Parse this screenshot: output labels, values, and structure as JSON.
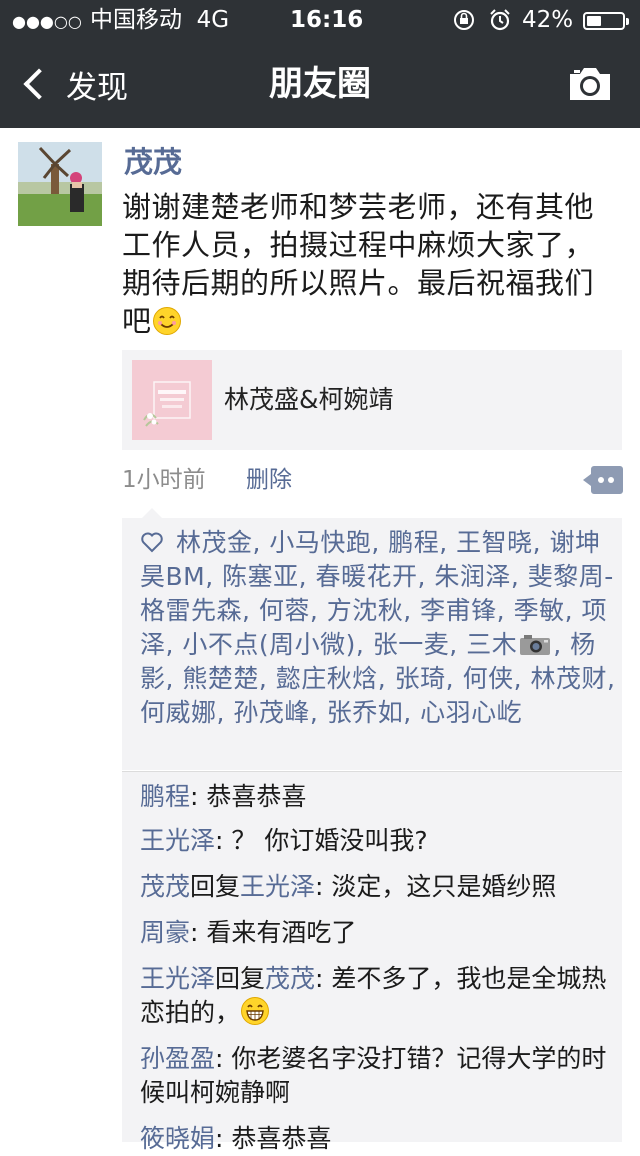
{
  "status_bar": {
    "signal": "●●●○○",
    "carrier": "中国移动",
    "network": "4G",
    "time": "16:16",
    "battery_percent": "42%",
    "battery_level": 0.42
  },
  "nav": {
    "back_label": "发现",
    "title": "朋友圈",
    "right_icon": "camera-icon"
  },
  "post": {
    "author": "茂茂",
    "text": "谢谢建楚老师和梦芸老师，还有其他工作人员，拍摄过程中麻烦大家了，期待后期的所以照片。最后祝福我们吧",
    "link_title": "林茂盛&柯婉靖",
    "time_ago": "1小时前",
    "delete_label": "删除"
  },
  "likes": {
    "part1": "林茂金, 小马快跑, 鹏程, 王智晓, 谢坤昊BM, 陈塞亚, 春暖花开, 朱润泽, 斐黎周-格雷先森, 何蓉, 方沈秋, 李甫锋, 季敏, 项泽, 小不点(周小微), 张一麦, 三木",
    "part2": ", 杨 影, 熊楚楚, 懿庄秋焓, 张琦, 何侠, 林茂财, 何威娜, 孙茂峰, 张乔如, 心羽心屹"
  },
  "comments": [
    {
      "name": "鹏程",
      "text": ": 恭喜恭喜"
    },
    {
      "name": "王光泽",
      "text": ": ？ 你订婚没叫我?"
    },
    {
      "name": "茂茂",
      "reply_word": "回复",
      "reply_to": "王光泽",
      "text": ": 淡定，这只是婚纱照"
    },
    {
      "name": "周豪",
      "text": ": 看来有酒吃了"
    },
    {
      "name": "王光泽",
      "reply_word": "回复",
      "reply_to": "茂茂",
      "text": ": 差不多了，我也是全城热恋拍的，"
    },
    {
      "name": "孙盈盈",
      "text": ": 你老婆名字没打错？记得大学的时候叫柯婉静啊"
    },
    {
      "name": "筱晓娟",
      "text": ": 恭喜恭喜"
    }
  ]
}
